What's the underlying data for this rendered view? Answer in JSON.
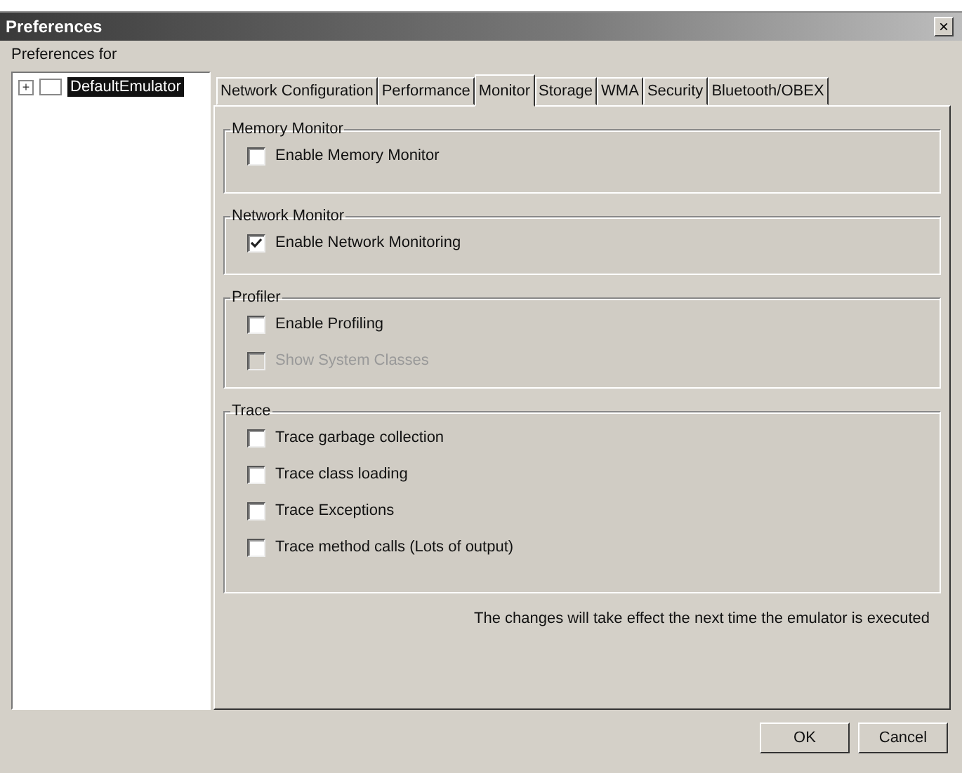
{
  "window": {
    "title": "Preferences",
    "close": "×"
  },
  "tree_label": "Preferences for",
  "tree": [
    {
      "label": "DefaultEmulator",
      "expander": "+",
      "selected": true
    }
  ],
  "tabs": [
    {
      "label": "Network Configuration",
      "selected": false
    },
    {
      "label": "Performance",
      "selected": false
    },
    {
      "label": "Monitor",
      "selected": true
    },
    {
      "label": "Storage",
      "selected": false
    },
    {
      "label": "WMA",
      "selected": false
    },
    {
      "label": "Security",
      "selected": false
    },
    {
      "label": "Bluetooth/OBEX",
      "selected": false
    }
  ],
  "groups": [
    {
      "title": "Memory Monitor",
      "options": [
        {
          "label": "Enable Memory Monitor",
          "checked": false,
          "disabled": false
        }
      ]
    },
    {
      "title": "Network Monitor",
      "options": [
        {
          "label": "Enable Network Monitoring",
          "checked": true,
          "disabled": false
        }
      ]
    },
    {
      "title": "Profiler",
      "options": [
        {
          "label": "Enable Profiling",
          "checked": false,
          "disabled": false
        },
        {
          "label": "Show System Classes",
          "checked": false,
          "disabled": true
        }
      ]
    },
    {
      "title": "Trace",
      "options": [
        {
          "label": "Trace garbage collection",
          "checked": false,
          "disabled": false
        },
        {
          "label": "Trace class loading",
          "checked": false,
          "disabled": false
        },
        {
          "label": "Trace Exceptions",
          "checked": false,
          "disabled": false
        },
        {
          "label": "Trace method calls (Lots of output)",
          "checked": false,
          "disabled": false
        }
      ]
    }
  ],
  "note": "The changes will take effect the next time the emulator is executed",
  "buttons": [
    "OK",
    "Cancel"
  ]
}
